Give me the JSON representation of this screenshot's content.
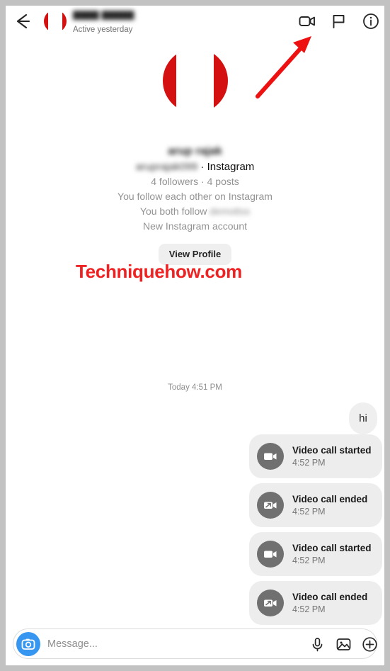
{
  "app": {
    "name": "Instagram Direct Message",
    "accent_blue": "#3797f0",
    "bubble_gray": "#efefef",
    "watermark_red": "#ee2222"
  },
  "header": {
    "back_icon": "back-arrow-icon",
    "avatar": "blurred-profile-avatar",
    "name": "████ █████",
    "status": "Active yesterday",
    "actions": [
      {
        "name": "video-call-icon",
        "label": "Video call"
      },
      {
        "name": "flag-icon",
        "label": "Flag"
      },
      {
        "name": "info-icon",
        "label": "Info"
      }
    ]
  },
  "annotation": {
    "type": "red-arrow",
    "points_to": "video-call-icon",
    "color": "#ee1111"
  },
  "profile": {
    "avatar": "blurred-large-avatar",
    "name": "arup rajak",
    "username": "aruprajak099",
    "platform_separator": " · ",
    "platform": "Instagram",
    "stats": "4 followers · 4 posts",
    "mutual_follow": "You follow each other on Instagram",
    "both_follow_prefix": "You both follow ",
    "both_follow_name": "demottss",
    "account_note": "New Instagram account",
    "view_profile_label": "View Profile"
  },
  "watermark": {
    "text": "Techniquehow.com"
  },
  "conversation": {
    "day_stamp": "Today 4:51 PM",
    "messages": [
      {
        "type": "text",
        "side": "right",
        "text": "hi"
      },
      {
        "type": "call-event",
        "icon": "video-call-started-icon",
        "title": "Video call started",
        "time": "4:52 PM"
      },
      {
        "type": "call-event",
        "icon": "video-call-ended-icon",
        "title": "Video call ended",
        "time": "4:52 PM"
      },
      {
        "type": "call-event",
        "icon": "video-call-started-icon",
        "title": "Video call started",
        "time": "4:52 PM"
      },
      {
        "type": "call-event",
        "icon": "video-call-ended-icon",
        "title": "Video call ended",
        "time": "4:52 PM"
      }
    ]
  },
  "composer": {
    "camera_icon": "camera-icon",
    "placeholder": "Message...",
    "value": "",
    "actions": [
      {
        "name": "microphone-icon",
        "label": "Voice message"
      },
      {
        "name": "image-icon",
        "label": "Photo"
      },
      {
        "name": "plus-icon",
        "label": "More"
      }
    ]
  }
}
